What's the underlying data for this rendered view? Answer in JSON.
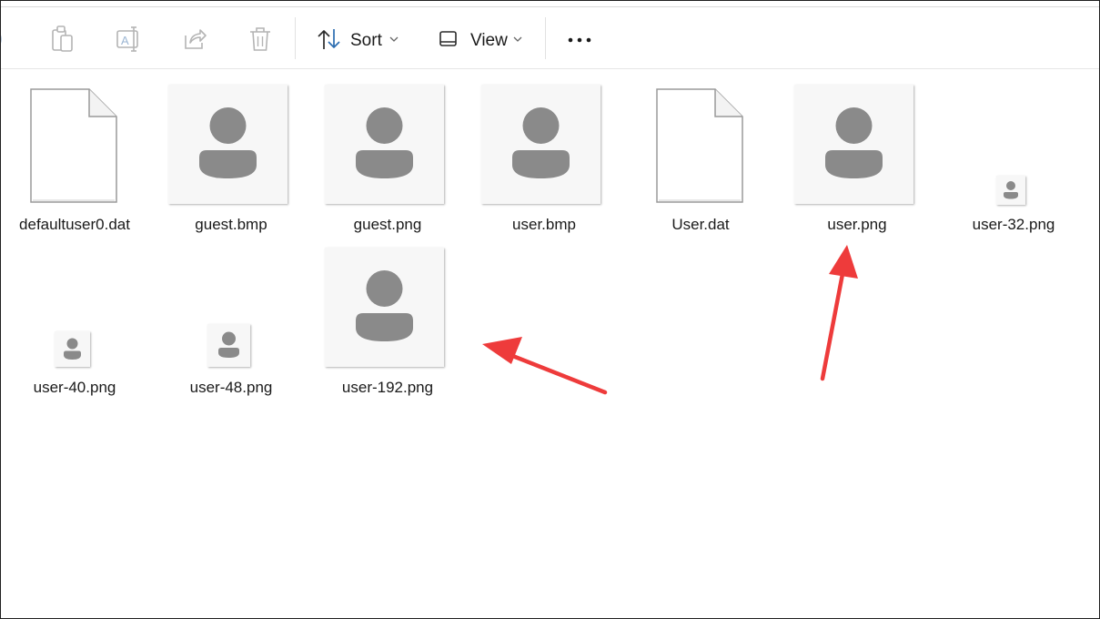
{
  "toolbar": {
    "copy_icon": "copy-icon",
    "paste_icon": "paste-icon",
    "rename_icon": "rename-icon",
    "share_icon": "share-icon",
    "delete_icon": "delete-icon",
    "sort_label": "Sort",
    "sort_icon": "sort-arrows-icon",
    "view_label": "View",
    "view_icon": "view-icon",
    "more_icon": "more-options-icon"
  },
  "files": [
    {
      "name": "defaultuser0.dat",
      "type": "document"
    },
    {
      "name": "guest.bmp",
      "type": "image"
    },
    {
      "name": "guest.png",
      "type": "image"
    },
    {
      "name": "user.bmp",
      "type": "image"
    },
    {
      "name": "User.dat",
      "type": "document"
    },
    {
      "name": "user.png",
      "type": "image"
    },
    {
      "name": "user-32.png",
      "type": "image-small"
    },
    {
      "name": "user-40.png",
      "type": "image-small"
    },
    {
      "name": "user-48.png",
      "type": "image-small"
    },
    {
      "name": "user-192.png",
      "type": "image"
    }
  ],
  "colors": {
    "annotation_arrow": "#ee3b3b",
    "avatar": "#8a8a8a",
    "sort_arrow_accent": "#2b6cb0"
  }
}
